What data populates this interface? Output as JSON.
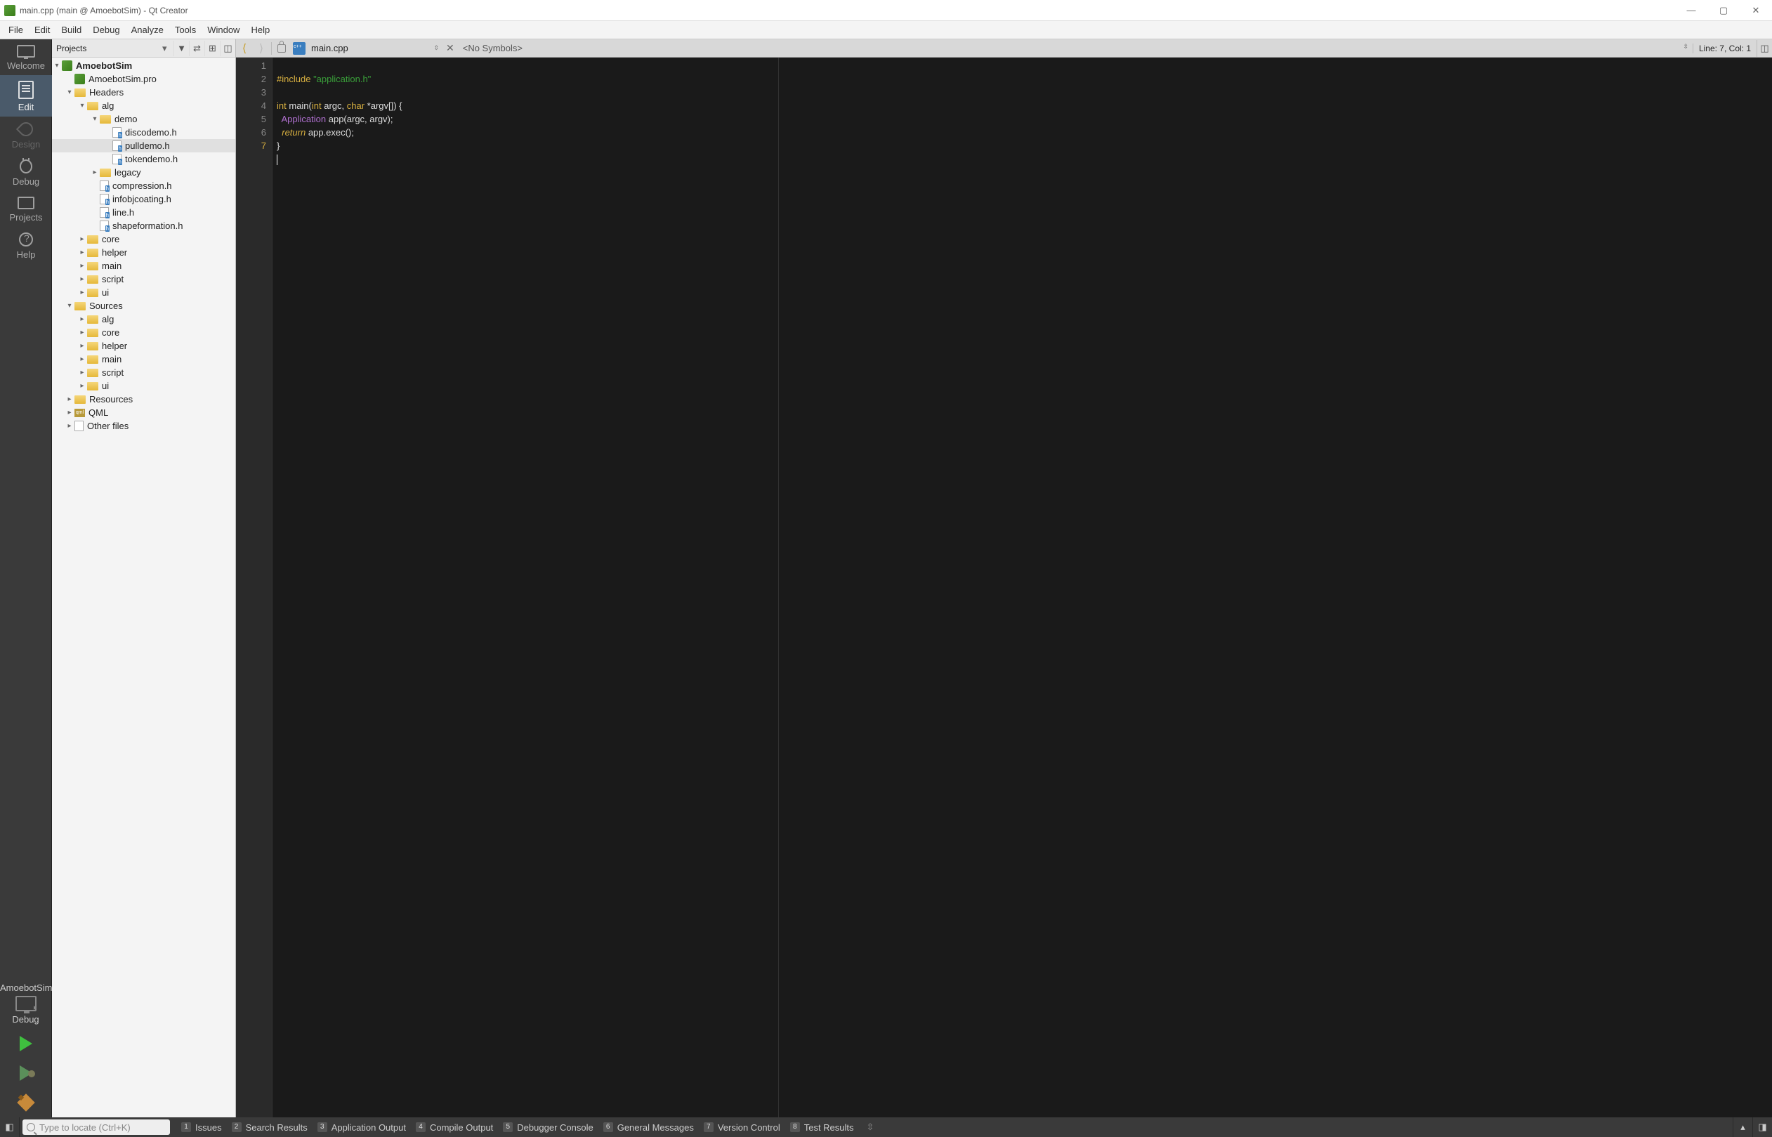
{
  "window": {
    "title": "main.cpp (main @ AmoebotSim) - Qt Creator"
  },
  "menubar": [
    "File",
    "Edit",
    "Build",
    "Debug",
    "Analyze",
    "Tools",
    "Window",
    "Help"
  ],
  "modebar": {
    "welcome": "Welcome",
    "edit": "Edit",
    "design": "Design",
    "debug": "Debug",
    "projects": "Projects",
    "help": "Help",
    "target_name": "AmoebotSim",
    "target_mode": "Debug"
  },
  "projects_panel": {
    "header": "Projects"
  },
  "tree": {
    "root": "AmoebotSim",
    "pro": "AmoebotSim.pro",
    "headers": "Headers",
    "alg": "alg",
    "demo": "demo",
    "demo_files": [
      "discodemo.h",
      "pulldemo.h",
      "tokendemo.h"
    ],
    "legacy": "legacy",
    "alg_files": [
      "compression.h",
      "infobjcoating.h",
      "line.h",
      "shapeformation.h"
    ],
    "core": "core",
    "helper": "helper",
    "main": "main",
    "script": "script",
    "ui": "ui",
    "sources": "Sources",
    "s_alg": "alg",
    "s_core": "core",
    "s_helper": "helper",
    "s_main": "main",
    "s_script": "script",
    "s_ui": "ui",
    "resources": "Resources",
    "qml": "QML",
    "other": "Other files"
  },
  "editor": {
    "filename": "main.cpp",
    "symbols": "<No Symbols>",
    "linecol": "Line: 7, Col: 1",
    "lines": [
      "1",
      "2",
      "3",
      "4",
      "5",
      "6",
      "7"
    ],
    "code": {
      "include": "#include",
      "inc_str": "\"application.h\"",
      "int": "int",
      "main": "main",
      "lp": "(",
      "arg1t": "int",
      "arg1": " argc, ",
      "chart": "char",
      "arg2": " *argv[]) {",
      "appTy": "Application",
      "appRest": " app(argc, argv);",
      "ret": "return",
      "retRest": " app.exec();",
      "close": "}"
    }
  },
  "locator": {
    "placeholder": "Type to locate (Ctrl+K)"
  },
  "outputs": {
    "1": "Issues",
    "2": "Search Results",
    "3": "Application Output",
    "4": "Compile Output",
    "5": "Debugger Console",
    "6": "General Messages",
    "7": "Version Control",
    "8": "Test Results"
  }
}
